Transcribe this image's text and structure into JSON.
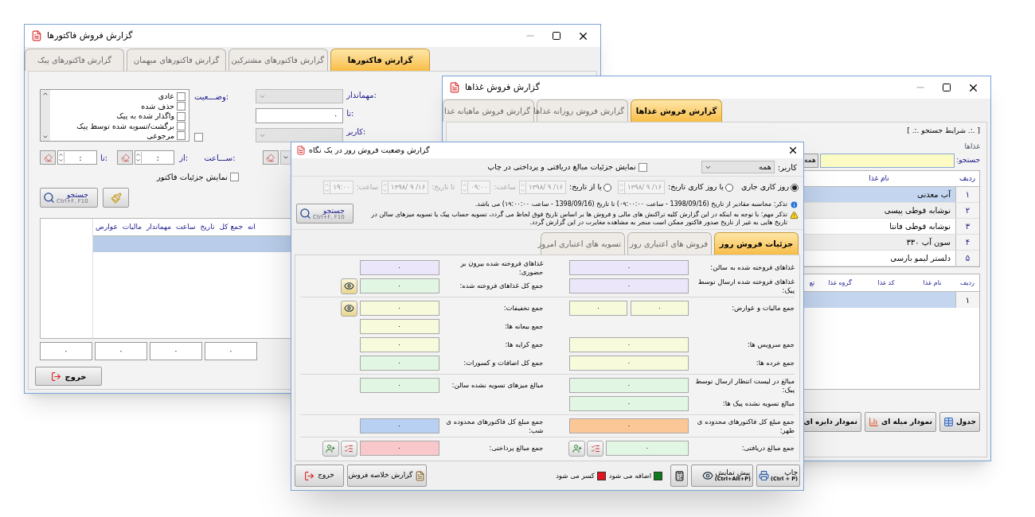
{
  "invoice_window": {
    "title": "گزارش فروش فاکتورها",
    "tabs": [
      {
        "label": "گزارش فاکتورها",
        "selected": true
      },
      {
        "label": "گزارش فاکتورهای مشترکین",
        "selected": false
      },
      {
        "label": "گزارش فاکتورهای میهمان",
        "selected": false
      },
      {
        "label": "گزارش فاکتورهای پیک",
        "selected": false
      }
    ],
    "status_label": "وضـــعیت:",
    "status_options": [
      {
        "label": "عادی",
        "checked": false
      },
      {
        "label": "حذف شده",
        "checked": false
      },
      {
        "label": "واگذار شده به پیک",
        "checked": false
      },
      {
        "label": "برگشت/تسویه شده توسط پیک",
        "checked": false
      },
      {
        "label": "مرجوعی",
        "checked": false
      }
    ],
    "select_all_checked": false,
    "host_label": "مهماندار:",
    "to_label": "تا:",
    "to_value": "۰",
    "user_label": "کاربر:",
    "time_label": "ســـاعت:",
    "from_label": "از:",
    "from_time": ":",
    "to_time_label": "تا:",
    "to_time": ":",
    "details_checkbox": {
      "label": "نمایش جزئیات فاکتور",
      "checked": false
    },
    "search_button": {
      "label": "جستجو",
      "shortcut": "Ctrl+F, F10"
    },
    "columns": [
      "انه",
      "جمع کل",
      "تاریخ",
      "ساعت",
      "مهماندار",
      "مالیات",
      "عوارض"
    ],
    "totals": [
      "۰",
      "۰",
      "۰",
      "۰"
    ],
    "exit_button": "خروج"
  },
  "food_window": {
    "title": "گزارش فروش غذاها",
    "tabs": [
      {
        "label": "گزارش فروش غذاها",
        "selected": true
      },
      {
        "label": "گزارش فروش روزانه غذاها",
        "selected": false
      },
      {
        "label": "گزارش فروش ماهیانه غذا",
        "selected": false
      }
    ],
    "criteria_title": "[ .:. شرایط جستجو .:. ]",
    "group_label": "غذاها",
    "search_label": "جستجو:",
    "all_button": "همه",
    "food_columns": [
      "ردیف",
      "نام غذا"
    ],
    "food_rows": [
      {
        "index": "۱",
        "name": "آب معدنی",
        "selected": true
      },
      {
        "index": "۲",
        "name": "نوشابه قوطی پپسی",
        "selected": false
      },
      {
        "index": "۳",
        "name": "نوشابه قوطی فانتا",
        "selected": false
      },
      {
        "index": "۴",
        "name": "سون آپ ۳۳۰",
        "selected": false
      },
      {
        "index": "۵",
        "name": "دلستر لیمو بارسی",
        "selected": false
      }
    ],
    "sales_columns": [
      "ردیف",
      "نام غذا",
      "کد غذا",
      "گروه غذا",
      "تع"
    ],
    "sales_rows": [
      {
        "index": "۱",
        "selected": true
      }
    ],
    "view_buttons": [
      {
        "label": "جدول",
        "kind": "table"
      },
      {
        "label": "نمودار میله ای",
        "kind": "bar"
      },
      {
        "label": "نمودار دایره ای",
        "kind": "pie"
      }
    ]
  },
  "summary_window": {
    "title": "گزارش وضعیت فروش روز در یک نگاه",
    "user_label": "کاربر:",
    "user_value": "همه",
    "print_details": {
      "label": "نمایش جزئیات مبالغ دریافتی و پرداختی در چاپ",
      "checked": false
    },
    "range_options": [
      {
        "label": "روز کاری جاری",
        "selected": true
      },
      {
        "label": "یا روز کاری تاریخ:",
        "selected": false
      },
      {
        "label": "یا از تاریخ:",
        "selected": false
      }
    ],
    "workday_date": "۱۳۹۸/ ۹ /۱۶",
    "from_date": "۱۳۹۸/ ۹ /۱۶",
    "from_time_label": "ساعت:",
    "from_time": "۰۹:۰۰",
    "to_date_label": "تا تاریخ:",
    "to_date": "۱۳۹۸/ ۹ /۱۶",
    "to_time_label": "ساعت:",
    "to_time": "۱۹:۰۰",
    "info_note": "تذکر: محاسبه مقادیر از تاریخ (1398/09/16 - ساعت ۰۹:۰۰:۰۰) تا تاریخ (1398/09/16 - ساعت ۱۹:۰۰:۰۰) می باشد.",
    "warning_note": "تذکر مهم: با توجه به اینکه در این گزارش کلیه تراکنش های مالی و فروش ها بر اساس تاریخ فوق لحاظ می گردد، تسویه حساب پیک یا تسویه میزهای سالن در تاریخ هایی به غیر از تاریخ صدور فاکتور ممکن است منجر به مشاهده مغایرت در این گزارش گردد.",
    "search_button": {
      "label": "جستجو",
      "shortcut": "Ctrl+F, F10"
    },
    "tabs": [
      {
        "label": "جزئیات فروش روز",
        "selected": true
      },
      {
        "label": "فروش های اعتباری روز",
        "selected": false
      },
      {
        "label": "تسویه های اعتباری امروز",
        "selected": false
      }
    ],
    "sections": [
      [
        {
          "right": {
            "label": "غذاهای فروخته شده به سالن:",
            "values": [
              "۰"
            ],
            "color": "#ece6fb",
            "kind": "plain"
          },
          "left": {
            "label": "غذاهای فروخته شده بیرون بر حضوری:",
            "values": [
              "۰"
            ],
            "color": "#ece6fb",
            "kind": "plain"
          }
        },
        {
          "right": {
            "label": "غذاهای فروخته شده ارسال توسط پیک:",
            "values": [
              "۰"
            ],
            "color": "#ece6fb",
            "kind": "plain"
          },
          "left": {
            "label": "جمع کل غذاهای فروخته شده:",
            "values": [
              "۰"
            ],
            "color": "#e2f6e4",
            "kind": "detail"
          }
        }
      ],
      [
        {
          "right": {
            "label": "جمع مالیات و عوارض:",
            "values": [
              "۰",
              "۰"
            ],
            "color": "#f8fadc",
            "kind": "plain"
          },
          "left": {
            "label": "جمع تخفیفات:",
            "values": [
              "۰"
            ],
            "color": "#f8fadc",
            "kind": "detail"
          }
        },
        {
          "left": {
            "label": "جمع بیعانه ها:",
            "values": [
              "۰"
            ],
            "color": "#f8fadc",
            "kind": "plain"
          }
        },
        {
          "right": {
            "label": "جمع سرویس ها:",
            "values": [
              "۰"
            ],
            "color": "#f8fadc",
            "kind": "plain"
          },
          "left": {
            "label": "جمع کرایه ها:",
            "values": [
              "۰"
            ],
            "color": "#f8fadc",
            "kind": "plain"
          }
        },
        {
          "right": {
            "label": "جمع خرده ها:",
            "values": [
              "۰"
            ],
            "color": "#f8fadc",
            "kind": "plain"
          },
          "left": {
            "label": "جمع کل اضافات و کسورات:",
            "values": [
              "۰"
            ],
            "color": "#e2f6e4",
            "kind": "plain"
          }
        }
      ],
      [
        {
          "right": {
            "label": "مبالغ در لیست انتظار ارسال توسط پیک:",
            "values": [
              "۰"
            ],
            "color": "#e2f6e4",
            "kind": "plain"
          },
          "left": {
            "label": "مبالغ میزهای تسویه نشده سالن:",
            "values": [
              "۰"
            ],
            "color": "#e2f6e4",
            "kind": "plain"
          }
        },
        {
          "right": {
            "label": "مبالغ تسویه نشده پیک ها:",
            "values": [
              "۰"
            ],
            "color": "#e2f6e4",
            "kind": "plain"
          }
        }
      ],
      [
        {
          "right": {
            "label": "جمع مبلغ کل فاکتورهای محدوده ی ظهر:",
            "values": [
              "۰"
            ],
            "color": "#fbc797",
            "kind": "plain"
          },
          "left": {
            "label": "جمع مبلغ کل فاکتورهای محدوده ی شب:",
            "values": [
              "۰"
            ],
            "color": "#b8d1f3",
            "kind": "plain"
          }
        }
      ],
      [
        {
          "right": {
            "label": "جمع مبالغ دریافتی:",
            "values": [
              "۰"
            ],
            "color": "#e2f6e4",
            "kind": "transfer"
          },
          "left": {
            "label": "جمع مبالغ پرداختی:",
            "values": [
              "۰"
            ],
            "color": "#f9c8ca",
            "kind": "transfer"
          }
        }
      ]
    ],
    "print_button": {
      "label": "چاپ",
      "shortcut": "(Ctrl + P)"
    },
    "preview_button": {
      "label": "پیش نمایش",
      "shortcut": "(Ctrl+Alt+P)"
    },
    "legend": [
      {
        "label": "اضافه می شود",
        "color": "#0f7b1a"
      },
      {
        "label": "کسر می شود",
        "color": "#e0141e"
      }
    ],
    "summary_button": "گزارش خلاصه فروش",
    "exit_button": "خروج"
  }
}
